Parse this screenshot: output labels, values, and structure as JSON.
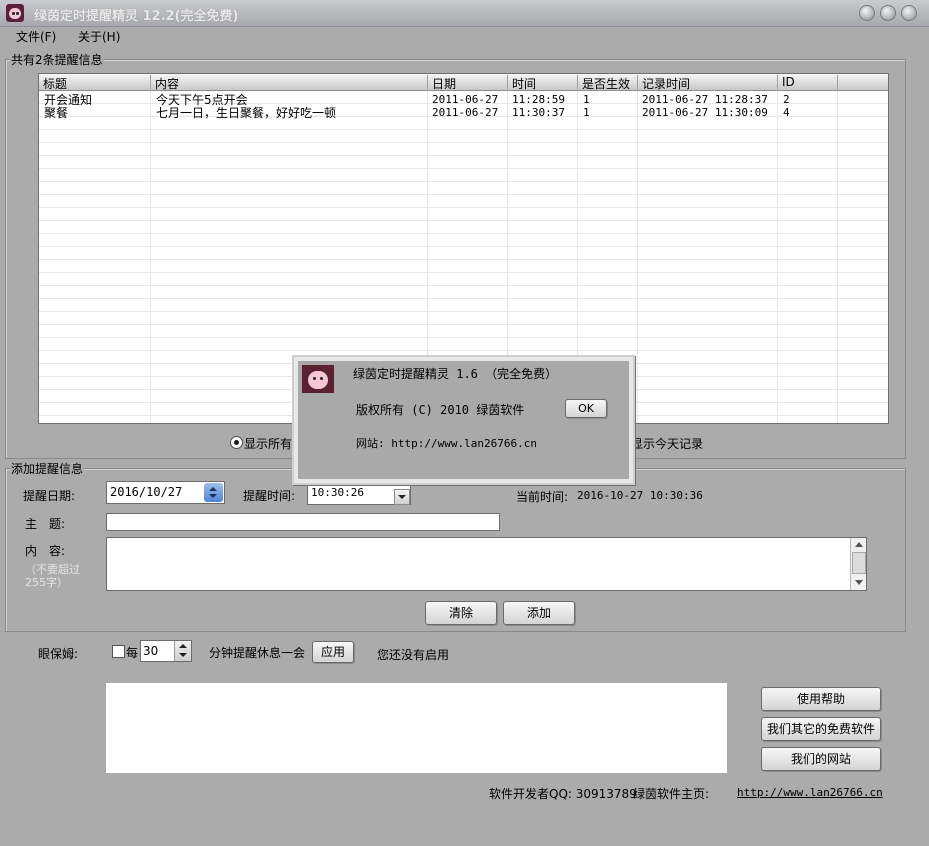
{
  "window": {
    "title": "绿茵定时提醒精灵 12.2(完全免费)",
    "menu": [
      "文件(F)",
      "关于(H)"
    ]
  },
  "list_group": {
    "label": "共有2条提醒信息",
    "columns": [
      "标题",
      "内容",
      "日期",
      "时间",
      "是否生效",
      "记录时间",
      "ID"
    ],
    "rows": [
      [
        "开会通知",
        "今天下午5点开会",
        "2011-06-27",
        "11:28:59",
        "1",
        "2011-06-27 11:28:37",
        "2"
      ],
      [
        "聚餐",
        "七月一日，生日聚餐，好好吃一顿",
        "2011-06-27",
        "11:30:37",
        "1",
        "2011-06-27 11:30:09",
        "4"
      ]
    ],
    "radio_all": "显示所有",
    "radio_today": "显示今天记录"
  },
  "add_group": {
    "label": "添加提醒信息",
    "date_label": "提醒日期:",
    "date_value": "2016/10/27",
    "time_label": "提醒时间:",
    "time_value": "10:30:26",
    "current_time_label": "当前时间:",
    "current_time_value": "2016-10-27 10:30:36",
    "subject_label": "主　题:",
    "subject_value": "",
    "content_label": "内　容:",
    "content_hint": "（不要超过255字）",
    "clear_button": "清除",
    "add_button": "添加"
  },
  "eye_care": {
    "label": "眼保姆:",
    "every_label": "每",
    "minutes_value": "30",
    "suffix_label": "分钟提醒休息一会",
    "apply_button": "应用",
    "status": "您还没有启用"
  },
  "side_buttons": [
    "使用帮助",
    "我们其它的免费软件",
    "我们的网站"
  ],
  "footer": {
    "developer": "软件开发者QQ: 30913789",
    "homepage_label": "绿茵软件主页:",
    "homepage_url": "http://www.lan26766.cn"
  },
  "about_dialog": {
    "title": "绿茵定时提醒精灵 1.6 （完全免费）",
    "copyright": "版权所有 (C) 2010  绿茵软件",
    "ok_button": "OK",
    "website": "网站: http://www.lan26766.cn"
  },
  "colors": {
    "window_bg": "#ababab",
    "list_bg": "#ffffff",
    "dialog_bg": "#a9a9a9"
  },
  "icons": [
    "app-icon",
    "minimize-icon",
    "maximize-icon",
    "close-icon",
    "spin-up-icon",
    "spin-down-icon",
    "dropdown-arrow-icon",
    "scroll-up-icon",
    "scroll-down-icon"
  ]
}
